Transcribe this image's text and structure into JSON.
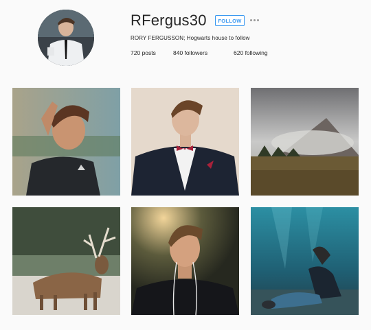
{
  "profile": {
    "username": "RFergus30",
    "follow_label": "FOLLOW",
    "bio": "RORY FERGUSSON; Hogwarts house to follow",
    "stats": {
      "posts_count": "720",
      "posts_label": "posts",
      "followers_count": "840",
      "followers_label": "followers",
      "following_count": "620",
      "following_label": "following"
    }
  },
  "colors": {
    "accent": "#3897f0",
    "background": "#fafafa"
  },
  "posts": [
    {
      "subject": "boy-touching-hair"
    },
    {
      "subject": "boy-in-tuxedo"
    },
    {
      "subject": "misty-mountain"
    },
    {
      "subject": "stag-in-field"
    },
    {
      "subject": "boy-with-earphones"
    },
    {
      "subject": "underwater-figure"
    }
  ]
}
